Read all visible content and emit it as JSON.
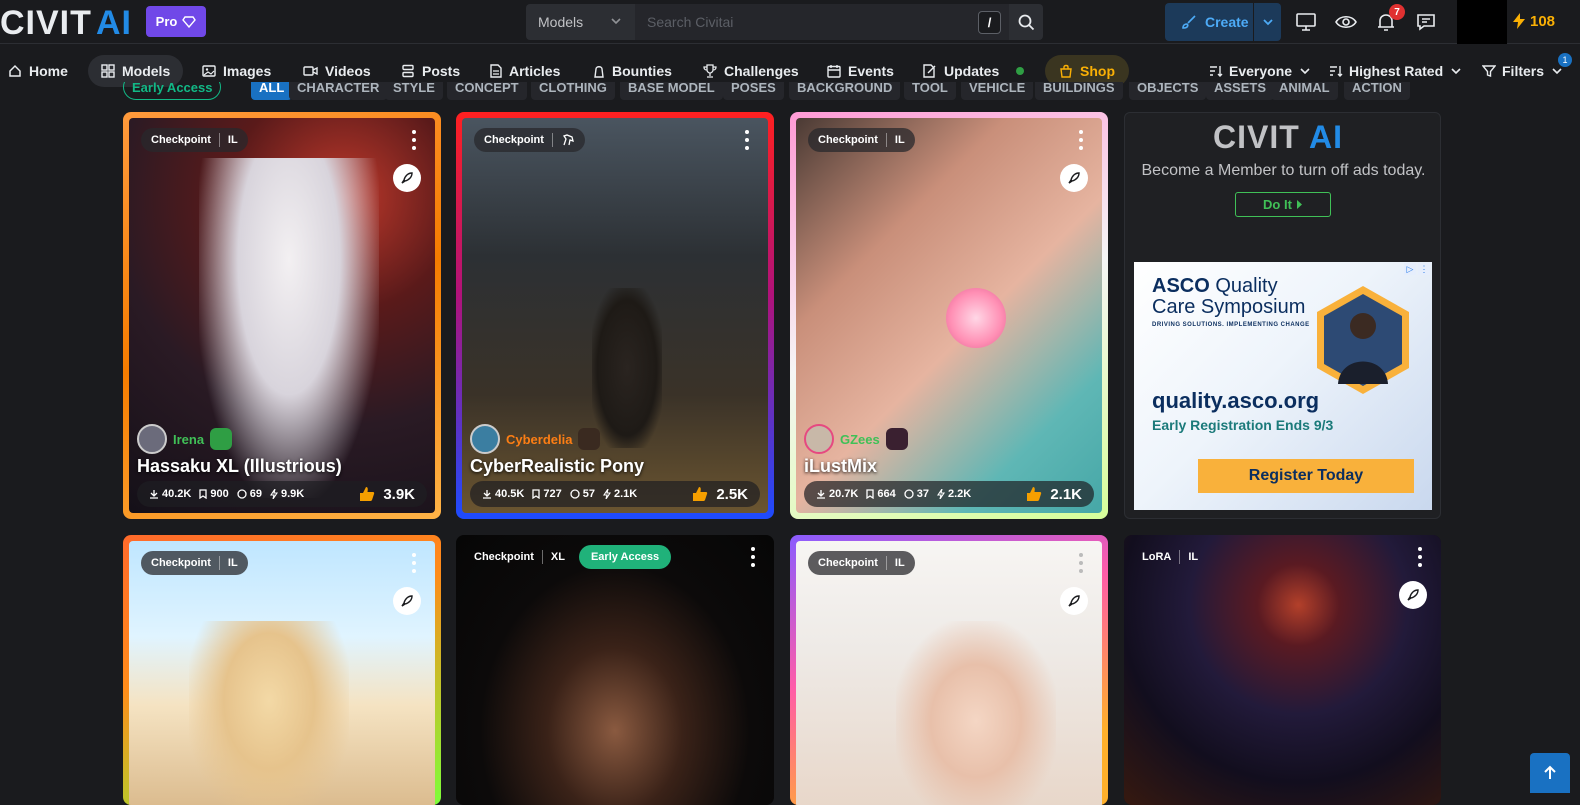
{
  "header": {
    "pro_label": "Pro",
    "search_category": "Models",
    "search_placeholder": "Search Civitai",
    "slash_key": "/",
    "create_label": "Create",
    "notification_count": "7",
    "buzz_count": "108"
  },
  "nav": {
    "items": [
      {
        "label": "Home",
        "icon": "home-icon"
      },
      {
        "label": "Models",
        "icon": "grid-icon"
      },
      {
        "label": "Images",
        "icon": "image-icon"
      },
      {
        "label": "Videos",
        "icon": "video-icon"
      },
      {
        "label": "Posts",
        "icon": "posts-icon"
      },
      {
        "label": "Articles",
        "icon": "article-icon"
      },
      {
        "label": "Bounties",
        "icon": "bounty-icon"
      },
      {
        "label": "Challenges",
        "icon": "trophy-icon"
      },
      {
        "label": "Events",
        "icon": "calendar-icon"
      },
      {
        "label": "Updates",
        "icon": "updates-icon"
      },
      {
        "label": "Shop",
        "icon": "shop-icon"
      }
    ],
    "filters": {
      "audience": "Everyone",
      "sort": "Highest Rated",
      "filters_label": "Filters",
      "filters_count": "1"
    }
  },
  "chips": [
    "Early Access",
    "ALL",
    "CHARACTER",
    "STYLE",
    "CONCEPT",
    "CLOTHING",
    "BASE MODEL",
    "POSES",
    "BACKGROUND",
    "TOOL",
    "VEHICLE",
    "BUILDINGS",
    "OBJECTS",
    "ASSETS",
    "ANIMAL",
    "ACTION"
  ],
  "cards": [
    {
      "type": "Checkpoint",
      "base": "IL",
      "creator": "Irena",
      "title": "Hassaku XL (Illustrious)",
      "downloads": "40.2K",
      "saves": "900",
      "comments": "69",
      "buzz": "9.9K",
      "likes": "3.9K",
      "creator_color": "#40c057"
    },
    {
      "type": "Checkpoint",
      "base": "",
      "creator": "Cyberdelia",
      "title": "CyberRealistic Pony",
      "downloads": "40.5K",
      "saves": "727",
      "comments": "57",
      "buzz": "2.1K",
      "likes": "2.5K",
      "creator_color": "#fd7e14"
    },
    {
      "type": "Checkpoint",
      "base": "IL",
      "creator": "GZees",
      "title": "iLustMix",
      "downloads": "20.7K",
      "saves": "664",
      "comments": "37",
      "buzz": "2.2K",
      "likes": "2.1K",
      "creator_color": "#40c057"
    },
    {
      "type": "Checkpoint",
      "base": "IL"
    },
    {
      "type": "Checkpoint",
      "base": "XL",
      "early_access": "Early Access"
    },
    {
      "type": "Checkpoint",
      "base": "IL"
    },
    {
      "type": "LoRA",
      "base": "IL"
    }
  ],
  "ad": {
    "text": "Become a Member to turn off ads today.",
    "button": "Do It",
    "banner": {
      "brand": "ASCO",
      "line1": "Quality",
      "line2": "Care Symposium",
      "tagline": "DRIVING SOLUTIONS. IMPLEMENTING CHANGE",
      "url": "quality.asco.org",
      "early": "Early Registration Ends 9/3",
      "cta": "Register Today"
    }
  }
}
